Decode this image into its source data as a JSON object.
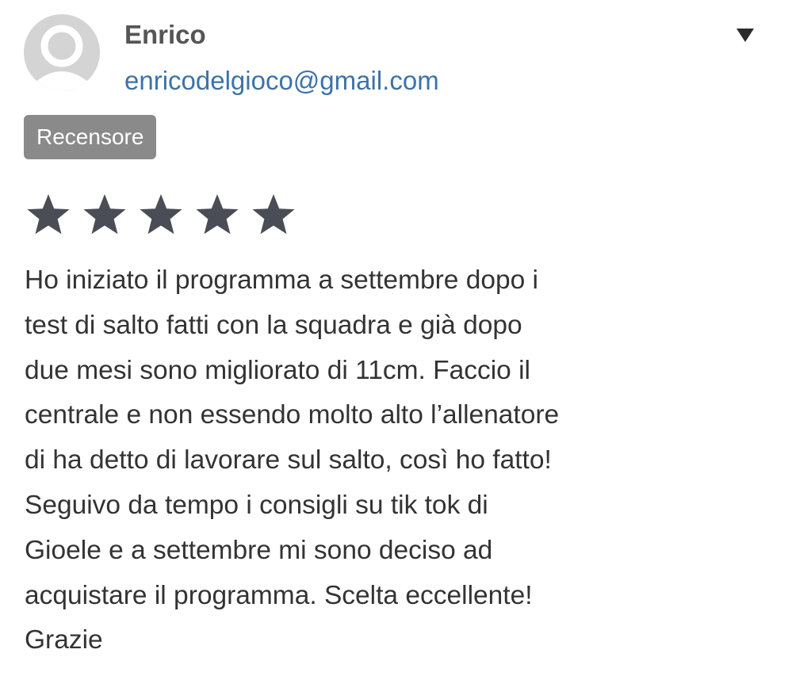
{
  "reviewer": {
    "name": "Enrico",
    "email": "enricodelgioco@gmail.com",
    "role_badge": "Recensore",
    "avatar_icon": "default-user-avatar-icon"
  },
  "dropdown": {
    "icon": "caret-down-icon"
  },
  "rating": {
    "value": 5,
    "max": 5,
    "star_color": "#4a4d55"
  },
  "review": {
    "lines": [
      "Ho iniziato il programma a settembre dopo i",
      "test di salto fatti con la squadra e già dopo",
      "due mesi sono migliorato di 11cm. Faccio il",
      "centrale e non essendo molto alto l’allenatore",
      "di ha detto di lavorare sul salto, così ho fatto!",
      "Seguivo da tempo i consigli su tik tok di",
      "Gioele e a settembre mi sono deciso ad",
      "acquistare il programma. Scelta eccellente!",
      "Grazie"
    ]
  },
  "colors": {
    "email_link": "#3c73aa",
    "badge_background": "#8a8a8a",
    "avatar_background": "#d4d4d4"
  }
}
